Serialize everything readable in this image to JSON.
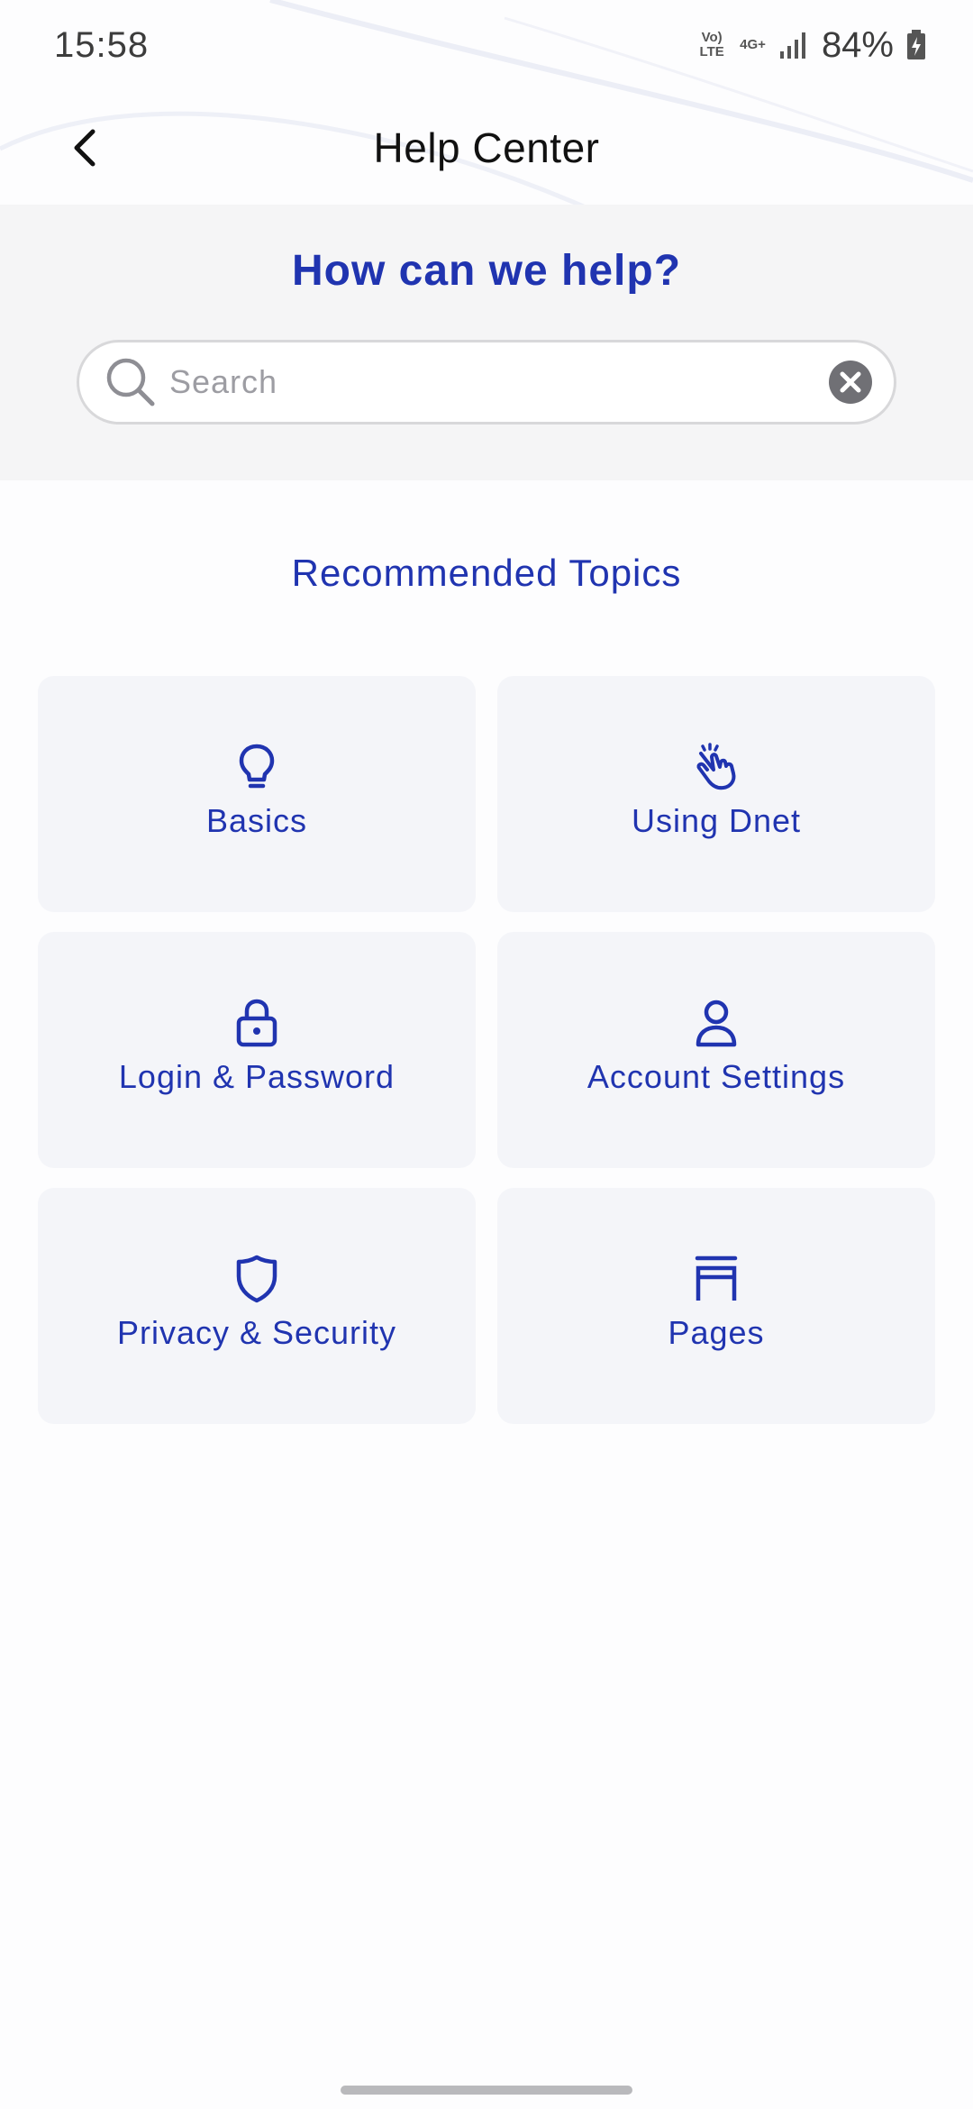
{
  "status_bar": {
    "time": "15:58",
    "network_volte": "Vo) LTE",
    "network_type": "4G+",
    "battery": "84%"
  },
  "app_bar": {
    "title": "Help Center",
    "back_icon": "chevron-left-icon"
  },
  "help_header": {
    "question": "How can we help?",
    "search": {
      "placeholder": "Search",
      "value": "",
      "search_icon": "search-icon",
      "clear_icon": "clear-icon"
    }
  },
  "recommended": {
    "title": "Recommended Topics",
    "topics": [
      {
        "label": "Basics",
        "icon": "lightbulb-icon"
      },
      {
        "label": "Using Dnet",
        "icon": "hand-tap-icon"
      },
      {
        "label": "Login & Password",
        "icon": "lock-icon"
      },
      {
        "label": "Account Settings",
        "icon": "user-icon"
      },
      {
        "label": "Privacy & Security",
        "icon": "shield-icon"
      },
      {
        "label": "Pages",
        "icon": "pages-icon"
      }
    ]
  },
  "colors": {
    "accent": "#2034b0",
    "header_background": "#f5f5f6",
    "card_background": "#f4f5f9"
  }
}
